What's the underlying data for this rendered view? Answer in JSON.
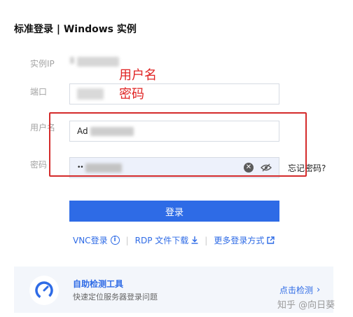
{
  "title": "标准登录 | Windows 实例",
  "form": {
    "ip_label": "实例IP",
    "port_label": "端口",
    "username_label": "用户名",
    "password_label": "密码",
    "username_value": "Ad",
    "password_value": "••",
    "forgot_label": "忘记密码?"
  },
  "annotation": {
    "line1": "用户名",
    "line2": "密码",
    "color": "#e02323"
  },
  "login_button_label": "登录",
  "links": {
    "vnc": "VNC登录",
    "rdp": "RDP 文件下载",
    "more": "更多登录方式"
  },
  "tool_card": {
    "title": "自助检测工具",
    "subtitle": "快速定位服务器登录问题",
    "action": "点击检测"
  },
  "watermark": "知乎 @向日葵",
  "colors": {
    "accent": "#2e6be6",
    "annotation_red": "#d42b2b",
    "card_bg": "#f3f6fb"
  },
  "icons": [
    "info-icon",
    "download-icon",
    "external-link-icon",
    "clear-icon",
    "eye-off-icon",
    "gauge-icon",
    "chevron-right-icon"
  ]
}
